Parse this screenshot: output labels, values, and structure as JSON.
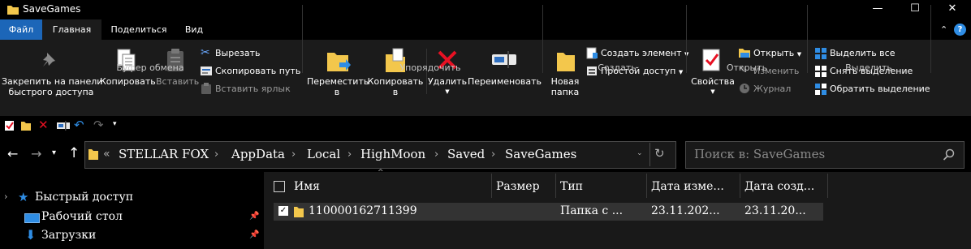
{
  "window": {
    "title": "SaveGames",
    "controls": {
      "minimize": "—",
      "maximize": "☐",
      "close": "✕"
    }
  },
  "ribbon_tabs": [
    {
      "label": "Файл"
    },
    {
      "label": "Главная"
    },
    {
      "label": "Поделиться"
    },
    {
      "label": "Вид"
    }
  ],
  "ribbon": {
    "clipboard": {
      "group_label": "Буфер обмена",
      "pin_label_line1": "Закрепить на панели",
      "pin_label_line2": "быстрого доступа",
      "copy_label": "Копировать",
      "paste_label": "Вставить",
      "cut_label": "Вырезать",
      "copy_path_label": "Скопировать путь",
      "paste_shortcut_label": "Вставить ярлык"
    },
    "organize": {
      "group_label": "Упорядочить",
      "move_label_line1": "Переместить",
      "move_label_line2": "в",
      "copyto_label_line1": "Копировать",
      "copyto_label_line2": "в",
      "delete_label": "Удалить",
      "rename_label": "Переименовать"
    },
    "new": {
      "group_label": "Создать",
      "new_folder_line1": "Новая",
      "new_folder_line2": "папка",
      "new_item_label": "Создать элемент",
      "easy_access_label": "Простой доступ"
    },
    "open": {
      "group_label": "Открыть",
      "properties_label": "Свойства",
      "open_label": "Открыть",
      "edit_label": "Изменить",
      "history_label": "Журнал"
    },
    "select": {
      "group_label": "Выделить",
      "select_all_label": "Выделить все",
      "select_none_label": "Снять выделение",
      "invert_label": "Обратить выделение"
    }
  },
  "address": {
    "overflow": "«",
    "crumbs": [
      "STELLAR FOX",
      "AppData",
      "Local",
      "HighMoon",
      "Saved",
      "SaveGames"
    ],
    "separator": "›",
    "search_placeholder": "Поиск в: SaveGames"
  },
  "nav_pane": {
    "items": [
      {
        "label": "Быстрый доступ"
      },
      {
        "label": "Рабочий стол"
      },
      {
        "label": "Загрузки"
      }
    ]
  },
  "file_list": {
    "columns": [
      "Имя",
      "Размер",
      "Тип",
      "Дата изме...",
      "Дата созд..."
    ],
    "rows": [
      {
        "name": "110000162711399",
        "size": "",
        "type": "Папка с ...",
        "modified": "23.11.202...",
        "created": "23.11.20..."
      }
    ]
  },
  "colors": {
    "file_tab": "#1c66b8",
    "ribbon_bg": "#1b1b1b",
    "folder": "#f3c74c",
    "delete_red": "#e81123",
    "accent_blue": "#2f8de4"
  }
}
